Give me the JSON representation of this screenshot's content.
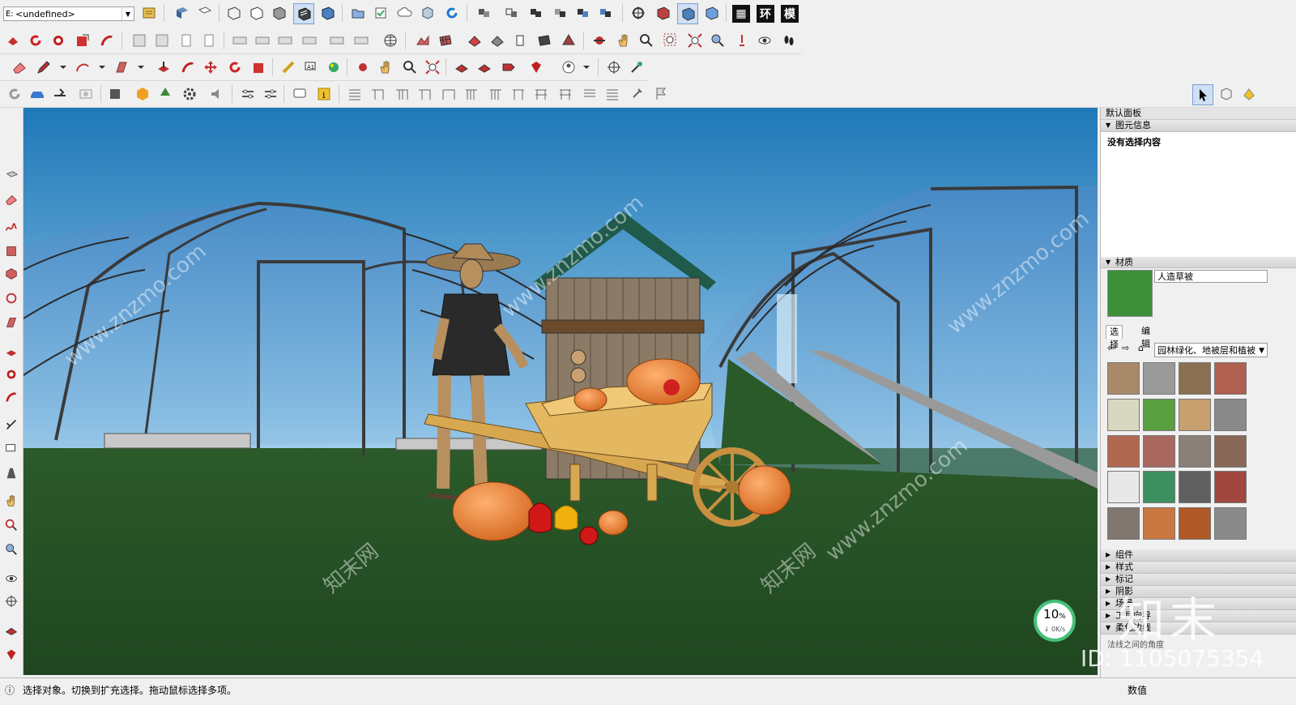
{
  "toolbar": {
    "layer_value": "<undefined>",
    "layer_prefix": "E:",
    "cjk_buttons": [
      "图",
      "环",
      "模"
    ]
  },
  "viewport": {
    "watermark_text": "www.znzmo.com",
    "watermark_cn": "知末网",
    "zoom_percent": "10",
    "zoom_unit": "%",
    "speed": "0K/s"
  },
  "tray": {
    "title": "默认面板",
    "entity_info": {
      "label": "图元信息",
      "content": "没有选择内容"
    },
    "materials": {
      "label": "材质",
      "name": "人造草被",
      "tab_select": "选择",
      "tab_edit": "编辑",
      "library": "园林绿化、地被层和植被",
      "swatch_colors": [
        "#a88a6a",
        "#9a9a9a",
        "#8a7050",
        "#b06050",
        "#d8d8c0",
        "#58a040",
        "#c8a070",
        "#8a8a8a",
        "#b06850",
        "#a86860",
        "#8a8078",
        "#8a6858",
        "#e8e8e8",
        "#3c9060",
        "#606060",
        "#a04840",
        "#807870",
        "#c87840",
        "#b05828",
        "#8a8a8a"
      ]
    },
    "sections": [
      "组件",
      "样式",
      "标记",
      "阴影",
      "场景",
      "工具向导",
      "柔化边线"
    ],
    "softening_hint": "法线之间的角度"
  },
  "status": {
    "left_text": "选择对象。切换到扩充选择。拖动鼠标选择多项。",
    "right_label": "数值"
  },
  "watermark": {
    "brand": "知末",
    "id_text": "ID: 1105075354"
  }
}
